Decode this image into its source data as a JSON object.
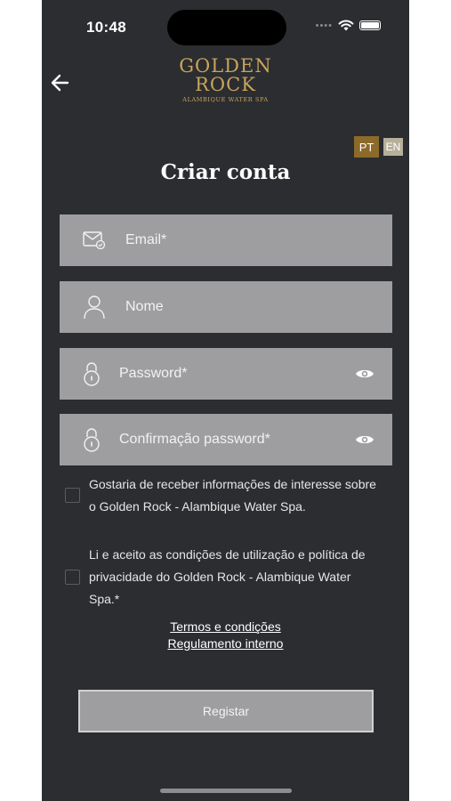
{
  "status": {
    "time": "10:48"
  },
  "logo": {
    "line1": "GOLDEN",
    "line2": "ROCK",
    "sub": "ALAMBIQUE WATER SPA"
  },
  "language": {
    "pt": "PT",
    "en": "EN",
    "selected": "PT"
  },
  "title": "Criar conta",
  "fields": {
    "email": {
      "placeholder": "Email*",
      "value": "",
      "icon": "envelope-icon"
    },
    "name": {
      "placeholder": "Nome",
      "value": "",
      "icon": "user-icon"
    },
    "password": {
      "placeholder": "Password*",
      "value": "",
      "icon": "lock-icon"
    },
    "confirm": {
      "placeholder": "Confirmação password*",
      "value": "",
      "icon": "lock-icon"
    }
  },
  "checkboxes": {
    "newsletter": "Gostaria de receber informações de interesse sobre o  Golden Rock - Alambique Water Spa.",
    "terms": "Li e aceito as condições de utilização e política de privacidade do  Golden Rock - Alambique Water Spa.*"
  },
  "links": {
    "terms": "Termos e condições",
    "rules": "Regulamento interno"
  },
  "register_label": "Registar",
  "colors": {
    "background": "#2b2d30",
    "field": "#9e9ea0",
    "gold": "#c9a45b",
    "pt_active": "#8c6a2a"
  }
}
